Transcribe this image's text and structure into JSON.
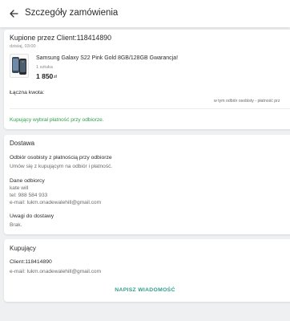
{
  "header": {
    "title": "Szczegóły zamówienia",
    "back_icon": "arrow-left-icon"
  },
  "order": {
    "client_heading": "Kupione przez Client:118414890",
    "date": "dzisiaj, 03:00",
    "product": {
      "title": "Samsung Galaxy S22 Pink Gold 8GB/128GB Gwarancja!",
      "quantity": "1 sztuka",
      "price": "1 850",
      "currency": "zł"
    },
    "total_label": "Łączna kwota:",
    "pickup_note": "w tym odbiór osobisty - płatność prz",
    "payment_note": "Kupujący wybrał płatność przy odbiorze."
  },
  "delivery": {
    "title": "Dostawa",
    "method_label": "Odbiór osobisty z płatnością przy odbiorze",
    "method_desc": "Umów się z kupującym na odbiór i płatność.",
    "recipient_label": "Dane odbiorcy",
    "recipient_name": "kate will",
    "recipient_phone": "tel: 988 584 933",
    "recipient_email": "e-mail: lukm.onadewalehill@gmail.com",
    "notes_label": "Uwagi do dostawy",
    "notes_value": "Brak."
  },
  "buyer": {
    "title": "Kupujący",
    "client": "Client:118414890",
    "email": "e-mail: lukm.onadewalehill@gmail.com",
    "message_button": "NAPISZ WIADOMOŚĆ"
  },
  "colors": {
    "accent_green": "#2f9e49",
    "button_teal": "#2f9e8a"
  }
}
